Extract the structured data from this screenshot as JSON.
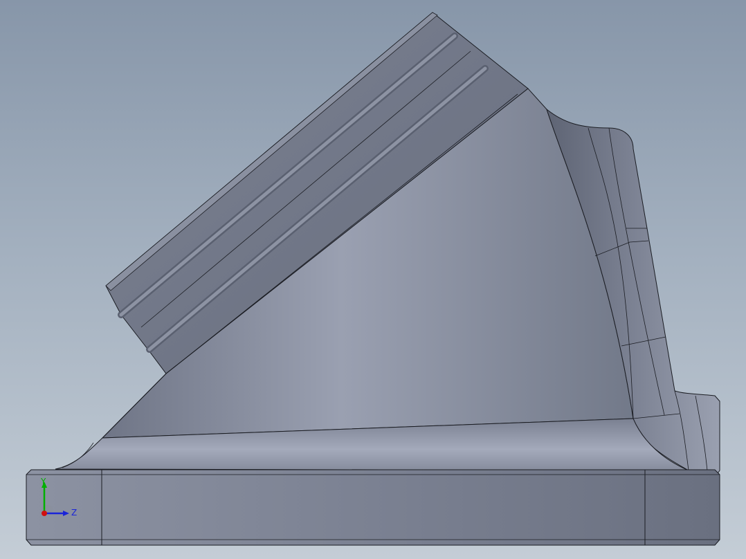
{
  "viewport": {
    "background_top": "#8796a9",
    "background_bottom": "#c4cdd6"
  },
  "model": {
    "face_color": "#7e8596",
    "highlight_color": "#a0a6b6",
    "edge_color": "#1a1c22"
  },
  "triad": {
    "y_label": "Y",
    "z_label": "Z",
    "y_color": "#00b000",
    "z_color": "#1a24d8",
    "x_color": "#d01010"
  }
}
